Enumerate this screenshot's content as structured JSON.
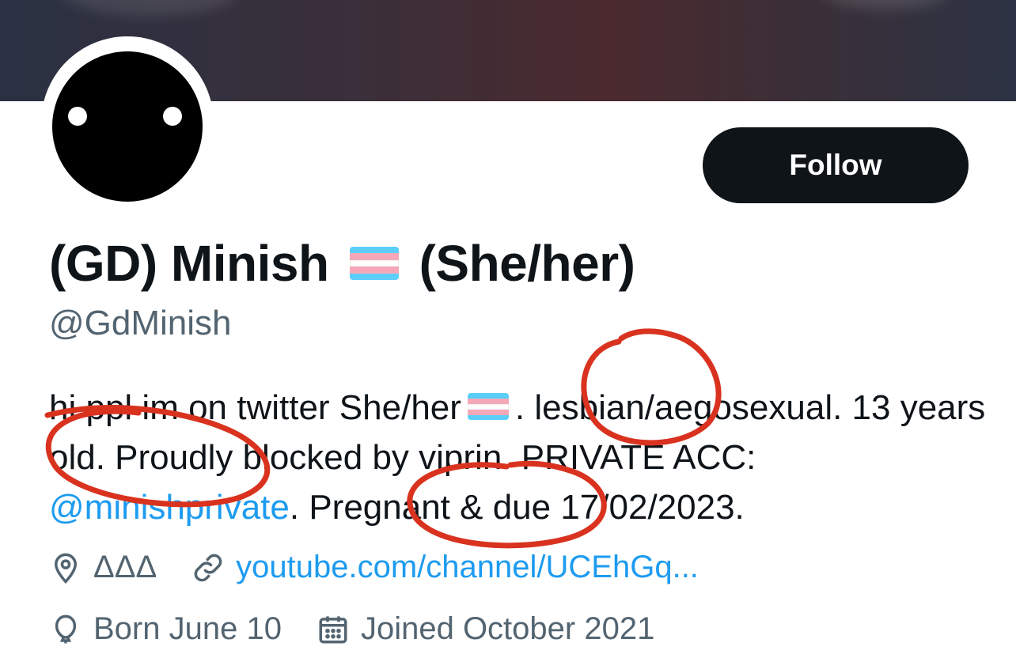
{
  "profile": {
    "name_prefix": "(GD) Minish",
    "name_suffix": "(She/her)",
    "handle": "@GdMinish",
    "follow_label": "Follow"
  },
  "bio": {
    "part1": "hi ppl im on twitter She/her",
    "part2": ". lesbian/aegosexual. 13 years old. Proudly blocked by viprin. PRIVATE ACC: ",
    "mention": "@minishprivate",
    "part3": ". Pregnant & due 17/02/2023."
  },
  "meta": {
    "location": "ΔΔΔ",
    "website": "youtube.com/channel/UCEhGq...",
    "birthday": "Born June 10",
    "joined": "Joined October 2021"
  },
  "icons": {
    "location": "location-pin-icon",
    "link": "link-icon",
    "birthday": "balloon-icon",
    "joined": "calendar-icon",
    "flag": "transgender-flag-icon"
  },
  "colors": {
    "text": "#0f1419",
    "secondary": "#536471",
    "link": "#1d9bf0",
    "button_bg": "#0f1419",
    "annotation": "#d9321f",
    "flag_blue": "#5bcefa",
    "flag_pink": "#f5a9b8"
  }
}
